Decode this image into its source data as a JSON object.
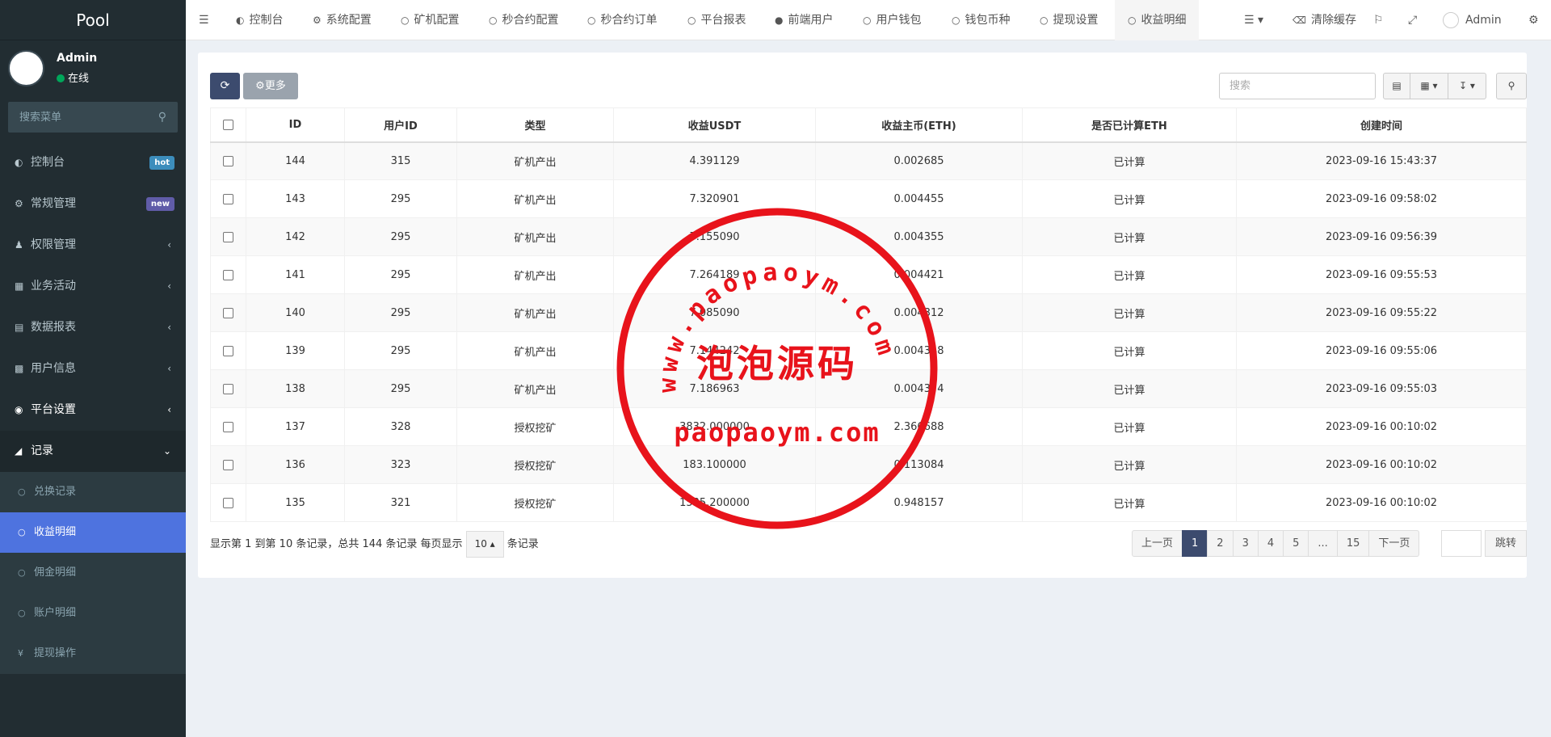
{
  "sidebar": {
    "logo": "Pool",
    "user": {
      "name": "Admin",
      "status": "在线"
    },
    "search_placeholder": "搜索菜单",
    "items": [
      {
        "label": "控制台",
        "icon": "dashboard-icon",
        "badge": "hot",
        "badge_color": "#3c8dbc"
      },
      {
        "label": "常规管理",
        "icon": "cogs-icon",
        "badge": "new",
        "badge_color": "#605ca8"
      },
      {
        "label": "权限管理",
        "icon": "group-icon"
      },
      {
        "label": "业务活动",
        "icon": "calendar-icon"
      },
      {
        "label": "数据报表",
        "icon": "file-icon"
      },
      {
        "label": "用户信息",
        "icon": "user-card-icon"
      },
      {
        "label": "平台设置",
        "icon": "settings-icon"
      },
      {
        "label": "记录",
        "icon": "chart-icon"
      }
    ],
    "submenu": [
      {
        "label": "兑换记录",
        "icon": "circle-icon"
      },
      {
        "label": "收益明细",
        "icon": "circle-icon"
      },
      {
        "label": "佣金明细",
        "icon": "circle-icon"
      },
      {
        "label": "账户明细",
        "icon": "circle-icon"
      },
      {
        "label": "提现操作",
        "icon": "yen-icon"
      }
    ]
  },
  "topbar": {
    "tabs": [
      "控制台",
      "系统配置",
      "矿机配置",
      "秒合约配置",
      "秒合约订单",
      "平台报表",
      "前端用户",
      "用户钱包",
      "钱包币种",
      "提现设置",
      "收益明细"
    ],
    "clear_cache": "清除缓存",
    "admin": "Admin"
  },
  "toolbar": {
    "more_label": "更多",
    "search_placeholder": "搜索"
  },
  "table": {
    "headers": [
      "ID",
      "用户ID",
      "类型",
      "收益USDT",
      "收益主币(ETH)",
      "是否已计算ETH",
      "创建时间"
    ],
    "rows": [
      [
        "144",
        "315",
        "矿机产出",
        "4.391129",
        "0.002685",
        "已计算",
        "2023-09-16 15:43:37"
      ],
      [
        "143",
        "295",
        "矿机产出",
        "7.320901",
        "0.004455",
        "已计算",
        "2023-09-16 09:58:02"
      ],
      [
        "142",
        "295",
        "矿机产出",
        "7.155090",
        "0.004355",
        "已计算",
        "2023-09-16 09:56:39"
      ],
      [
        "141",
        "295",
        "矿机产出",
        "7.264189",
        "0.004421",
        "已计算",
        "2023-09-16 09:55:53"
      ],
      [
        "140",
        "295",
        "矿机产出",
        "7.085090",
        "0.004312",
        "已计算",
        "2023-09-16 09:55:22"
      ],
      [
        "139",
        "295",
        "矿机产出",
        "7.144242",
        "0.004348",
        "已计算",
        "2023-09-16 09:55:06"
      ],
      [
        "138",
        "295",
        "矿机产出",
        "7.186963",
        "0.004374",
        "已计算",
        "2023-09-16 09:55:03"
      ],
      [
        "137",
        "328",
        "授权挖矿",
        "3832.000000",
        "2.366688",
        "已计算",
        "2023-09-16 00:10:02"
      ],
      [
        "136",
        "323",
        "授权挖矿",
        "183.100000",
        "0.113084",
        "已计算",
        "2023-09-16 00:10:02"
      ],
      [
        "135",
        "321",
        "授权挖矿",
        "1535.200000",
        "0.948157",
        "已计算",
        "2023-09-16 00:10:02"
      ]
    ]
  },
  "pagination": {
    "info_prefix": "显示第 1 到第 10 条记录，总共 144 条记录 每页显示",
    "page_size": "10",
    "info_suffix": "条记录",
    "prev": "上一页",
    "pages": [
      "1",
      "2",
      "3",
      "4",
      "5",
      "...",
      "15"
    ],
    "next": "下一页",
    "jump": "跳转"
  },
  "watermark": {
    "url_text": "www.paopaoym.com",
    "cn_text": "泡泡源码",
    "domain_text": "paopaoym.com",
    "color": "#e8131b"
  }
}
